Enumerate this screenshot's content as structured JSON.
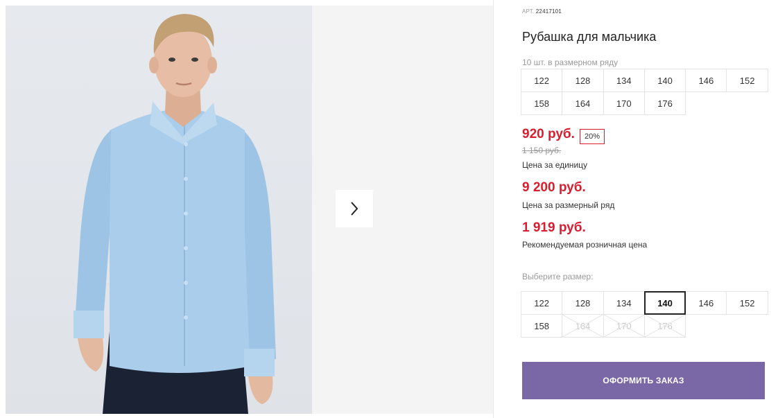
{
  "product": {
    "art_label": "АРТ.",
    "art_number": "22417101",
    "title": "Рубашка для мальчика",
    "row_count": "10 шт. в размерном ряду"
  },
  "size_row": [
    "122",
    "128",
    "134",
    "140",
    "146",
    "152",
    "158",
    "164",
    "170",
    "176"
  ],
  "pricing": {
    "unit_price": "920 руб.",
    "discount": "20%",
    "old_price": "1 150 руб.",
    "unit_caption": "Цена за единицу",
    "row_price": "9 200 руб.",
    "row_caption": "Цена за размерный ряд",
    "retail_price": "1 919 руб.",
    "retail_caption": "Рекомендуемая розничная цена"
  },
  "size_select": {
    "label": "Выберите размер:",
    "options": [
      {
        "label": "122",
        "state": "available"
      },
      {
        "label": "128",
        "state": "available"
      },
      {
        "label": "134",
        "state": "available"
      },
      {
        "label": "140",
        "state": "selected"
      },
      {
        "label": "146",
        "state": "available"
      },
      {
        "label": "152",
        "state": "available"
      },
      {
        "label": "158",
        "state": "available"
      },
      {
        "label": "164",
        "state": "disabled"
      },
      {
        "label": "170",
        "state": "disabled"
      },
      {
        "label": "176",
        "state": "disabled"
      }
    ]
  },
  "order_button": "ОФОРМИТЬ ЗАКАЗ",
  "icons": {
    "gallery_next": "chevron-right-icon"
  },
  "colors": {
    "price": "#d81e2e",
    "button": "#7a68a6",
    "shirt": "#a9cdea"
  }
}
